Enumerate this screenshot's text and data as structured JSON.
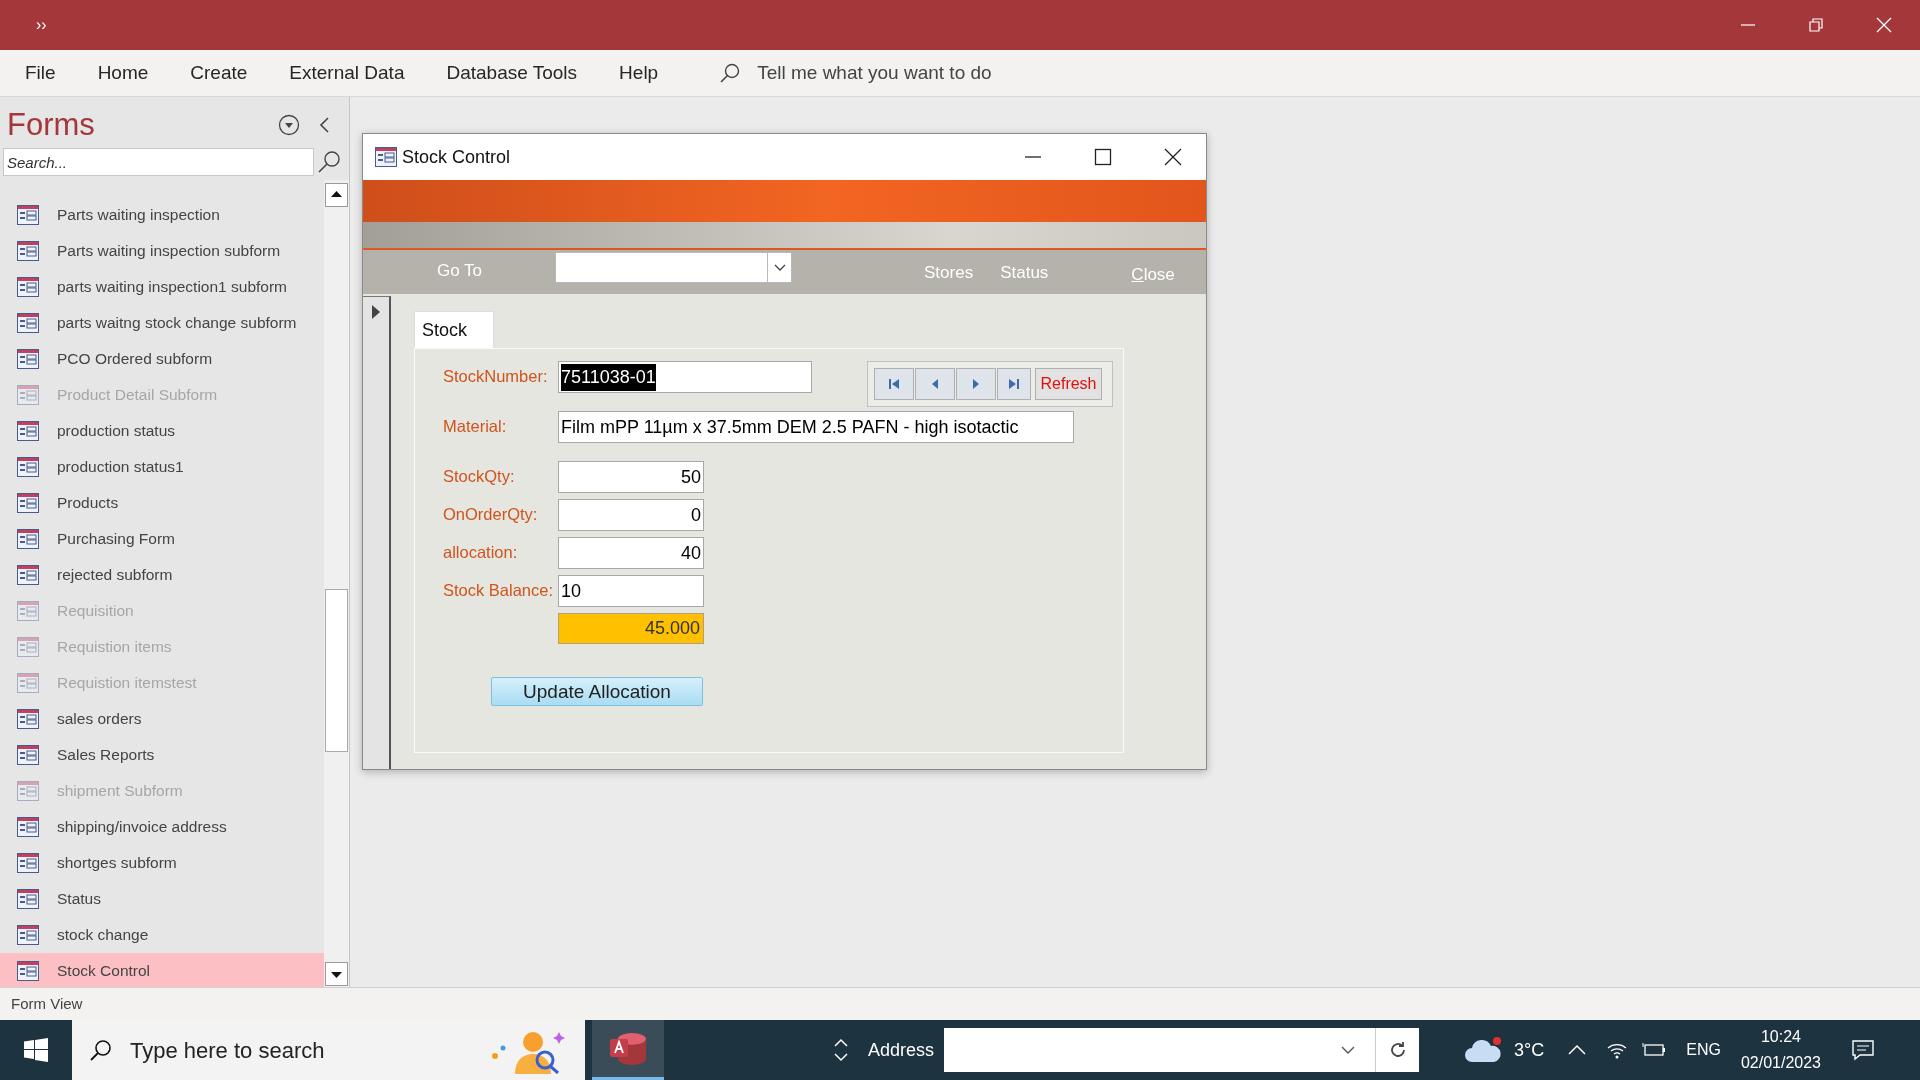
{
  "title_bar": {
    "quick_access": "››"
  },
  "ribbon": {
    "tabs": [
      "File",
      "Home",
      "Create",
      "External Data",
      "Database Tools",
      "Help"
    ],
    "tell_me": "Tell me what you want to do"
  },
  "nav_pane": {
    "title": "Forms",
    "search_placeholder": "Search...",
    "items": [
      {
        "label": "Parts waiting inspection",
        "disabled": false,
        "selected": false
      },
      {
        "label": "Parts waiting inspection subform",
        "disabled": false,
        "selected": false
      },
      {
        "label": "parts waiting inspection1 subform",
        "disabled": false,
        "selected": false
      },
      {
        "label": "parts waitng stock change subform",
        "disabled": false,
        "selected": false
      },
      {
        "label": "PCO Ordered subform",
        "disabled": false,
        "selected": false
      },
      {
        "label": "Product Detail Subform",
        "disabled": true,
        "selected": false
      },
      {
        "label": "production status",
        "disabled": false,
        "selected": false
      },
      {
        "label": "production status1",
        "disabled": false,
        "selected": false
      },
      {
        "label": "Products",
        "disabled": false,
        "selected": false
      },
      {
        "label": "Purchasing Form",
        "disabled": false,
        "selected": false
      },
      {
        "label": "rejected subform",
        "disabled": false,
        "selected": false
      },
      {
        "label": "Requisition",
        "disabled": true,
        "selected": false
      },
      {
        "label": "Requistion items",
        "disabled": true,
        "selected": false
      },
      {
        "label": "Requistion itemstest",
        "disabled": true,
        "selected": false
      },
      {
        "label": "sales orders",
        "disabled": false,
        "selected": false
      },
      {
        "label": "Sales Reports",
        "disabled": false,
        "selected": false
      },
      {
        "label": "shipment Subform",
        "disabled": true,
        "selected": false
      },
      {
        "label": "shipping/invoice address",
        "disabled": false,
        "selected": false
      },
      {
        "label": "shortges subform",
        "disabled": false,
        "selected": false
      },
      {
        "label": "Status",
        "disabled": false,
        "selected": false
      },
      {
        "label": "stock change",
        "disabled": false,
        "selected": false
      },
      {
        "label": "Stock Control",
        "disabled": false,
        "selected": true
      }
    ]
  },
  "form_window": {
    "title": "Stock Control",
    "goto_label": "Go To",
    "header_links": [
      "Stores",
      "Status"
    ],
    "close_link": "Close",
    "tab": {
      "label": "Stock",
      "selected": true
    },
    "fields": [
      {
        "kind": "text",
        "label": "StockNumber:",
        "value": "7511038-01",
        "text_selected": true
      },
      {
        "kind": "text",
        "label": "Material:",
        "value": "Film mPP 11µm x 37.5mm DEM 2.5 PAFN - high isotactic",
        "text_selected": false
      },
      {
        "kind": "number",
        "label": "StockQty:",
        "value": "50",
        "text_selected": false
      },
      {
        "kind": "number",
        "label": "OnOrderQty:",
        "value": "0",
        "text_selected": false
      },
      {
        "kind": "number",
        "label": "allocation:",
        "value": "40",
        "text_selected": false
      },
      {
        "kind": "text",
        "label": "Stock Balance:",
        "value": "10",
        "text_selected": false
      }
    ],
    "computed_value": "45.000",
    "refresh_button": "Refresh",
    "update_button": "Update Allocation"
  },
  "status_bar": "Form View",
  "taskbar": {
    "search_placeholder": "Type here to search",
    "address_label": "Address",
    "temperature": "3°C",
    "language": "ENG",
    "time": "10:24",
    "date": "02/01/2023"
  }
}
